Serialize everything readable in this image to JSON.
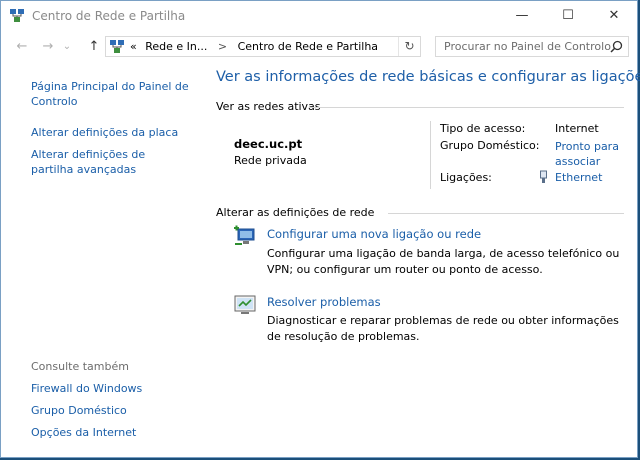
{
  "window": {
    "title": "Centro de Rede e Partilha",
    "buttons": {
      "minimize": "—",
      "maximize": "☐",
      "close": "✕"
    }
  },
  "nav": {
    "back": "←",
    "forward": "→",
    "recent": "⌄",
    "up": "↑",
    "address": {
      "overflow": "«",
      "crumbs": [
        "Rede e In...",
        "Centro de Rede e Partilha"
      ],
      "separator": ">",
      "refresh": "↻"
    },
    "search": {
      "placeholder": "Procurar no Painel de Controlo"
    }
  },
  "sidebar": {
    "links": [
      "Página Principal do Painel de Controlo",
      "Alterar definições da placa",
      "Alterar definições de partilha avançadas"
    ],
    "see_also": {
      "heading": "Consulte também",
      "links": [
        "Firewall do Windows",
        "Grupo Doméstico",
        "Opções da Internet"
      ]
    }
  },
  "main": {
    "title": "Ver as informações de rede básicas e configurar as ligações",
    "active_networks": {
      "heading": "Ver as redes ativas",
      "network_name": "deec.uc.pt",
      "network_type": "Rede privada",
      "access_type_label": "Tipo de acesso:",
      "access_type_value": "Internet",
      "homegroup_label": "Grupo Doméstico:",
      "homegroup_value": "Pronto para associar",
      "connections_label": "Ligações:",
      "connections_value": "Ethernet"
    },
    "change_settings": {
      "heading": "Alterar as definições de rede",
      "tasks": [
        {
          "icon": "new-connection-icon",
          "title": "Configurar uma nova ligação ou rede",
          "description": "Configurar uma ligação de banda larga, de acesso telefónico ou VPN; ou configurar um router ou ponto de acesso."
        },
        {
          "icon": "troubleshoot-icon",
          "title": "Resolver problemas",
          "description": "Diagnosticar e reparar problemas de rede ou obter informações de resolução de problemas."
        }
      ]
    }
  },
  "colors": {
    "link": "#1a5ea8",
    "title": "#1e5fa8",
    "desktop": "#1b4f7a"
  }
}
